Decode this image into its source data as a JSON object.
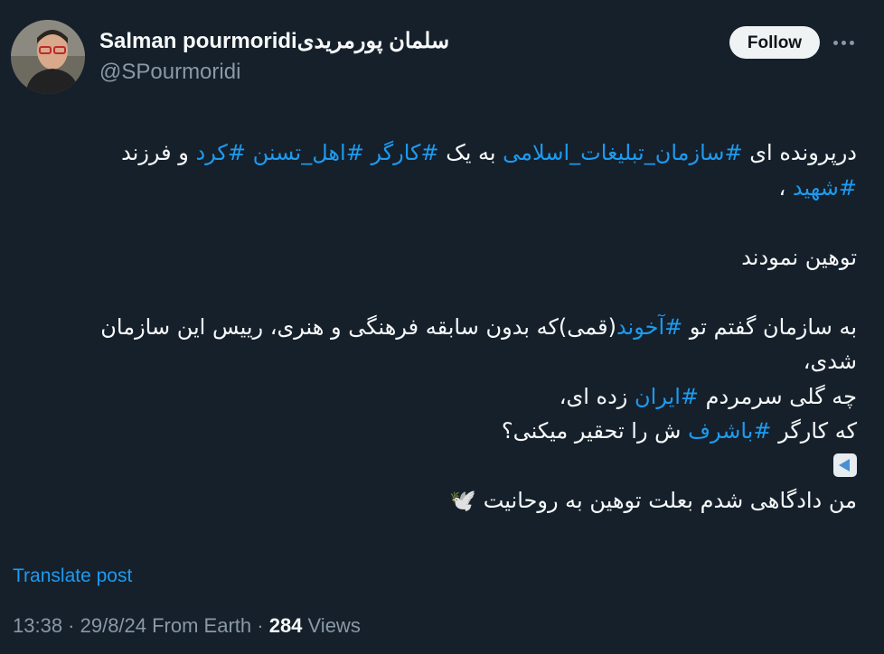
{
  "author": {
    "display_name": "Salman pourmoridiسلمان پورمریدی",
    "handle": "@SPourmoridi"
  },
  "actions": {
    "follow_label": "Follow"
  },
  "tweet": {
    "line1_a": "درپرونده ای ",
    "line1_tag1": "#سازمان_تبلیغات_اسلامی",
    "line1_b": " به یک ",
    "line1_tag2": "#کارگر",
    "line1_c": " ",
    "line1_tag3": "#اهل_تسنن",
    "line1_d": " ",
    "line1_tag4": "#کرد",
    "line1_e": " و فرزند",
    "line2_tag": "#شهید",
    "line2_a": " ،",
    "line3": "توهین نمودند",
    "line4_a": "به سازمان گفتم تو ",
    "line4_tag": "#آخوند",
    "line4_b": "(قمی)که بدون سابقه فرهنگی و هنری، رییس این سازمان",
    "line5": "شدی،",
    "line6_a": "چه گلی سرمردم ",
    "line6_tag": "#ایران",
    "line6_b": " زده ای،",
    "line7_a": "که کارگر ",
    "line7_tag": "#باشرف",
    "line7_b": " ش را تحقیر میکنی؟",
    "line9": "من دادگاهی شدم بعلت توهین به روحانیت 🕊️"
  },
  "translate_label": "Translate post",
  "meta": {
    "timestamp": "13:38 · 29/8/24 From Earth · ",
    "views_count": "284",
    "views_label": " Views"
  }
}
